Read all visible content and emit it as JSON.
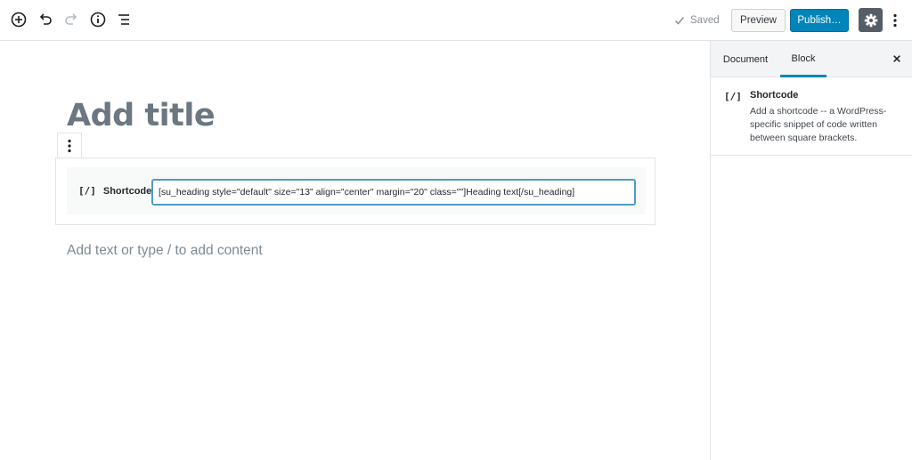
{
  "toolbar": {
    "add_block_icon": "plus-circle-icon",
    "undo_icon": "undo-icon",
    "redo_icon": "redo-icon",
    "info_icon": "info-icon",
    "outline_icon": "list-icon",
    "saved_label": "Saved",
    "preview_label": "Preview",
    "publish_label": "Publish…",
    "settings_icon": "gear-icon",
    "more_icon": "vertical-ellipsis-icon"
  },
  "editor": {
    "title_placeholder": "Add title",
    "shortcode_block": {
      "icon": "[/]",
      "label": "Shortcode",
      "value": "[su_heading style=\"default\" size=\"13\" align=\"center\" margin=\"20\" class=\"\"]Heading text[/su_heading]"
    },
    "paragraph_placeholder": "Add text or type / to add content"
  },
  "sidebar": {
    "tabs": [
      {
        "label": "Document"
      },
      {
        "label": "Block"
      }
    ],
    "active_tab": "Block",
    "block_card": {
      "icon": "[/]",
      "name": "Shortcode",
      "description": "Add a shortcode -- a WordPress-specific snippet of code written between square brackets."
    }
  },
  "colors": {
    "primary": "#0085ba",
    "settings_bg": "#555d66",
    "input_focus": "#4d9cc4",
    "placeholder_text": "#7e8993"
  }
}
